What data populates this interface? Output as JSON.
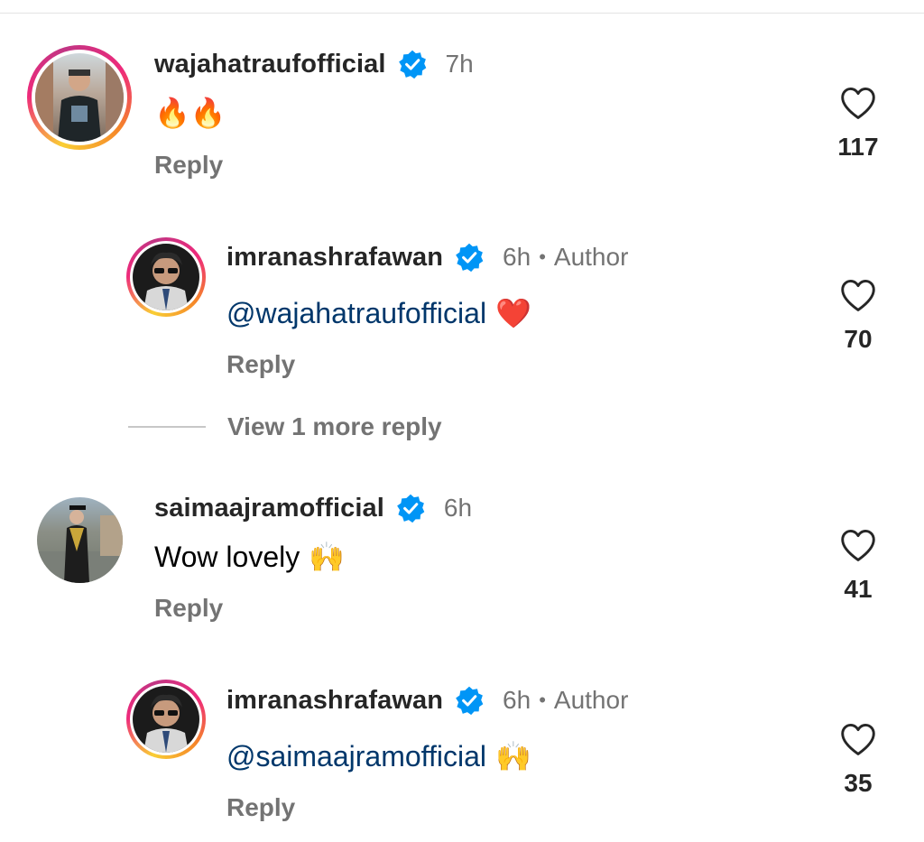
{
  "comments": [
    {
      "username": "wajahatraufofficial",
      "time": "7h",
      "text": "🔥🔥",
      "reply_label": "Reply",
      "likes": "117"
    },
    {
      "username": "imranashrafawan",
      "time": "6h",
      "author_label": "Author",
      "mention": "@wajahatraufofficial",
      "emoji": "❤️",
      "reply_label": "Reply",
      "likes": "70"
    },
    {
      "username": "saimaajramofficial",
      "time": "6h",
      "text": "Wow lovely",
      "emoji": "🙌",
      "reply_label": "Reply",
      "likes": "41"
    },
    {
      "username": "imranashrafawan",
      "time": "6h",
      "author_label": "Author",
      "mention": "@saimaajramofficial",
      "emoji": "🙌",
      "reply_label": "Reply",
      "likes": "35"
    }
  ],
  "view_more_replies": "View 1 more reply",
  "separator_dot": "•",
  "colors": {
    "verified": "#0095f6",
    "mention": "#00376b",
    "secondary": "#737373",
    "story_ring": [
      "#f9ce34",
      "#ee2a7b",
      "#c13584"
    ]
  }
}
